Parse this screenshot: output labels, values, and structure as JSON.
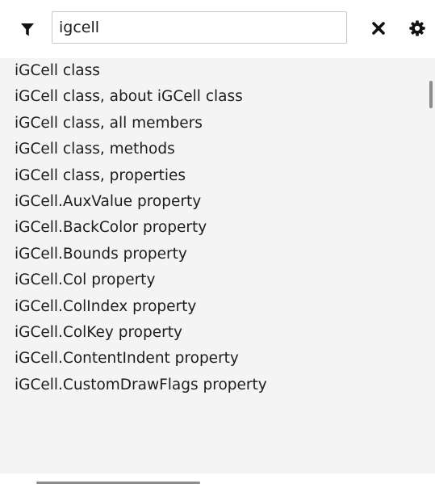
{
  "toolbar": {
    "filter_icon": "funnel-icon",
    "search_value": "igcell",
    "clear_icon": "close-icon",
    "settings_icon": "gear-icon"
  },
  "index_list": {
    "items": [
      "iGCell class",
      "iGCell class, about iGCell class",
      "iGCell class, all members",
      "iGCell class, methods",
      "iGCell class, properties",
      "iGCell.AuxValue property",
      "iGCell.BackColor property",
      "iGCell.Bounds property",
      "iGCell.Col property",
      "iGCell.ColIndex property",
      "iGCell.ColKey property",
      "iGCell.ContentIndent property",
      "iGCell.CustomDrawFlags property"
    ]
  }
}
